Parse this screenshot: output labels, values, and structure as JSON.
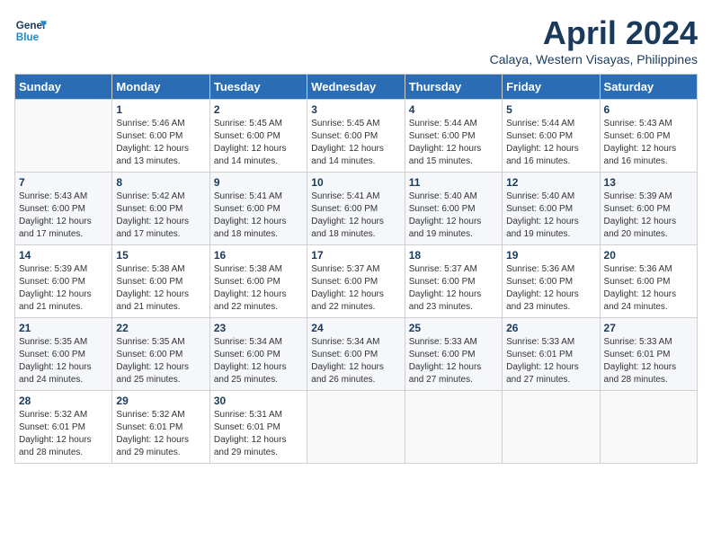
{
  "logo": {
    "line1": "General",
    "line2": "Blue"
  },
  "title": "April 2024",
  "subtitle": "Calaya, Western Visayas, Philippines",
  "header_days": [
    "Sunday",
    "Monday",
    "Tuesday",
    "Wednesday",
    "Thursday",
    "Friday",
    "Saturday"
  ],
  "weeks": [
    [
      {
        "day": "",
        "info": ""
      },
      {
        "day": "1",
        "info": "Sunrise: 5:46 AM\nSunset: 6:00 PM\nDaylight: 12 hours\nand 13 minutes."
      },
      {
        "day": "2",
        "info": "Sunrise: 5:45 AM\nSunset: 6:00 PM\nDaylight: 12 hours\nand 14 minutes."
      },
      {
        "day": "3",
        "info": "Sunrise: 5:45 AM\nSunset: 6:00 PM\nDaylight: 12 hours\nand 14 minutes."
      },
      {
        "day": "4",
        "info": "Sunrise: 5:44 AM\nSunset: 6:00 PM\nDaylight: 12 hours\nand 15 minutes."
      },
      {
        "day": "5",
        "info": "Sunrise: 5:44 AM\nSunset: 6:00 PM\nDaylight: 12 hours\nand 16 minutes."
      },
      {
        "day": "6",
        "info": "Sunrise: 5:43 AM\nSunset: 6:00 PM\nDaylight: 12 hours\nand 16 minutes."
      }
    ],
    [
      {
        "day": "7",
        "info": "Sunrise: 5:43 AM\nSunset: 6:00 PM\nDaylight: 12 hours\nand 17 minutes."
      },
      {
        "day": "8",
        "info": "Sunrise: 5:42 AM\nSunset: 6:00 PM\nDaylight: 12 hours\nand 17 minutes."
      },
      {
        "day": "9",
        "info": "Sunrise: 5:41 AM\nSunset: 6:00 PM\nDaylight: 12 hours\nand 18 minutes."
      },
      {
        "day": "10",
        "info": "Sunrise: 5:41 AM\nSunset: 6:00 PM\nDaylight: 12 hours\nand 18 minutes."
      },
      {
        "day": "11",
        "info": "Sunrise: 5:40 AM\nSunset: 6:00 PM\nDaylight: 12 hours\nand 19 minutes."
      },
      {
        "day": "12",
        "info": "Sunrise: 5:40 AM\nSunset: 6:00 PM\nDaylight: 12 hours\nand 19 minutes."
      },
      {
        "day": "13",
        "info": "Sunrise: 5:39 AM\nSunset: 6:00 PM\nDaylight: 12 hours\nand 20 minutes."
      }
    ],
    [
      {
        "day": "14",
        "info": "Sunrise: 5:39 AM\nSunset: 6:00 PM\nDaylight: 12 hours\nand 21 minutes."
      },
      {
        "day": "15",
        "info": "Sunrise: 5:38 AM\nSunset: 6:00 PM\nDaylight: 12 hours\nand 21 minutes."
      },
      {
        "day": "16",
        "info": "Sunrise: 5:38 AM\nSunset: 6:00 PM\nDaylight: 12 hours\nand 22 minutes."
      },
      {
        "day": "17",
        "info": "Sunrise: 5:37 AM\nSunset: 6:00 PM\nDaylight: 12 hours\nand 22 minutes."
      },
      {
        "day": "18",
        "info": "Sunrise: 5:37 AM\nSunset: 6:00 PM\nDaylight: 12 hours\nand 23 minutes."
      },
      {
        "day": "19",
        "info": "Sunrise: 5:36 AM\nSunset: 6:00 PM\nDaylight: 12 hours\nand 23 minutes."
      },
      {
        "day": "20",
        "info": "Sunrise: 5:36 AM\nSunset: 6:00 PM\nDaylight: 12 hours\nand 24 minutes."
      }
    ],
    [
      {
        "day": "21",
        "info": "Sunrise: 5:35 AM\nSunset: 6:00 PM\nDaylight: 12 hours\nand 24 minutes."
      },
      {
        "day": "22",
        "info": "Sunrise: 5:35 AM\nSunset: 6:00 PM\nDaylight: 12 hours\nand 25 minutes."
      },
      {
        "day": "23",
        "info": "Sunrise: 5:34 AM\nSunset: 6:00 PM\nDaylight: 12 hours\nand 25 minutes."
      },
      {
        "day": "24",
        "info": "Sunrise: 5:34 AM\nSunset: 6:00 PM\nDaylight: 12 hours\nand 26 minutes."
      },
      {
        "day": "25",
        "info": "Sunrise: 5:33 AM\nSunset: 6:00 PM\nDaylight: 12 hours\nand 27 minutes."
      },
      {
        "day": "26",
        "info": "Sunrise: 5:33 AM\nSunset: 6:01 PM\nDaylight: 12 hours\nand 27 minutes."
      },
      {
        "day": "27",
        "info": "Sunrise: 5:33 AM\nSunset: 6:01 PM\nDaylight: 12 hours\nand 28 minutes."
      }
    ],
    [
      {
        "day": "28",
        "info": "Sunrise: 5:32 AM\nSunset: 6:01 PM\nDaylight: 12 hours\nand 28 minutes."
      },
      {
        "day": "29",
        "info": "Sunrise: 5:32 AM\nSunset: 6:01 PM\nDaylight: 12 hours\nand 29 minutes."
      },
      {
        "day": "30",
        "info": "Sunrise: 5:31 AM\nSunset: 6:01 PM\nDaylight: 12 hours\nand 29 minutes."
      },
      {
        "day": "",
        "info": ""
      },
      {
        "day": "",
        "info": ""
      },
      {
        "day": "",
        "info": ""
      },
      {
        "day": "",
        "info": ""
      }
    ]
  ]
}
